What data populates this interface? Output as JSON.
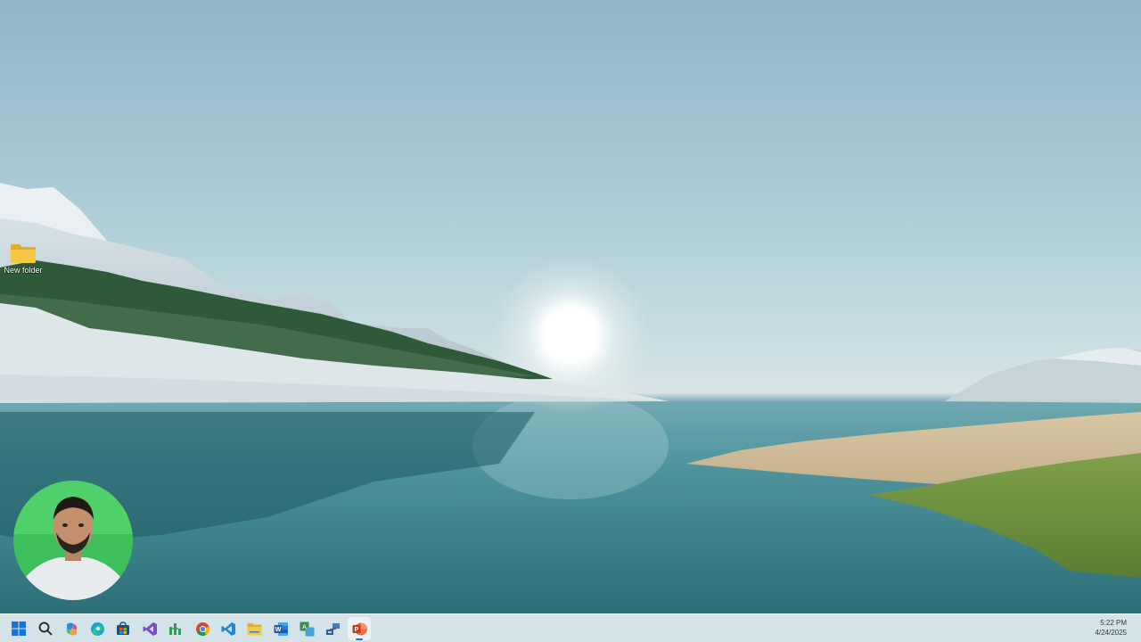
{
  "desktop": {
    "icons": [
      {
        "label": "New folder",
        "icon": "folder-icon"
      }
    ]
  },
  "taskbar": {
    "apps": [
      {
        "name": "start-button",
        "icon": "windows-logo-icon"
      },
      {
        "name": "search-button",
        "icon": "search-icon"
      },
      {
        "name": "copilot-button",
        "icon": "copilot-icon"
      },
      {
        "name": "edge-button",
        "icon": "edge-icon"
      },
      {
        "name": "store-button",
        "icon": "store-icon"
      },
      {
        "name": "visual-studio-button",
        "icon": "visual-studio-icon"
      },
      {
        "name": "chart-app-button",
        "icon": "chart-app-icon"
      },
      {
        "name": "chrome-button",
        "icon": "chrome-icon"
      },
      {
        "name": "vscode-button",
        "icon": "vscode-icon"
      },
      {
        "name": "file-explorer-button",
        "icon": "file-explorer-icon"
      },
      {
        "name": "word-button",
        "icon": "word-icon"
      },
      {
        "name": "translator-button",
        "icon": "translator-icon"
      },
      {
        "name": "network-tool-button",
        "icon": "network-tool-icon"
      },
      {
        "name": "powerpoint-button",
        "icon": "powerpoint-icon",
        "active": true
      }
    ],
    "clock": {
      "time": "5:22 PM",
      "date": "4/24/2025"
    }
  },
  "colors": {
    "taskbar": "#d4e3e7",
    "accent": "#1a73d9",
    "powerpoint": "#c43e1c",
    "word": "#2b5797",
    "folder": "#f4c843"
  }
}
